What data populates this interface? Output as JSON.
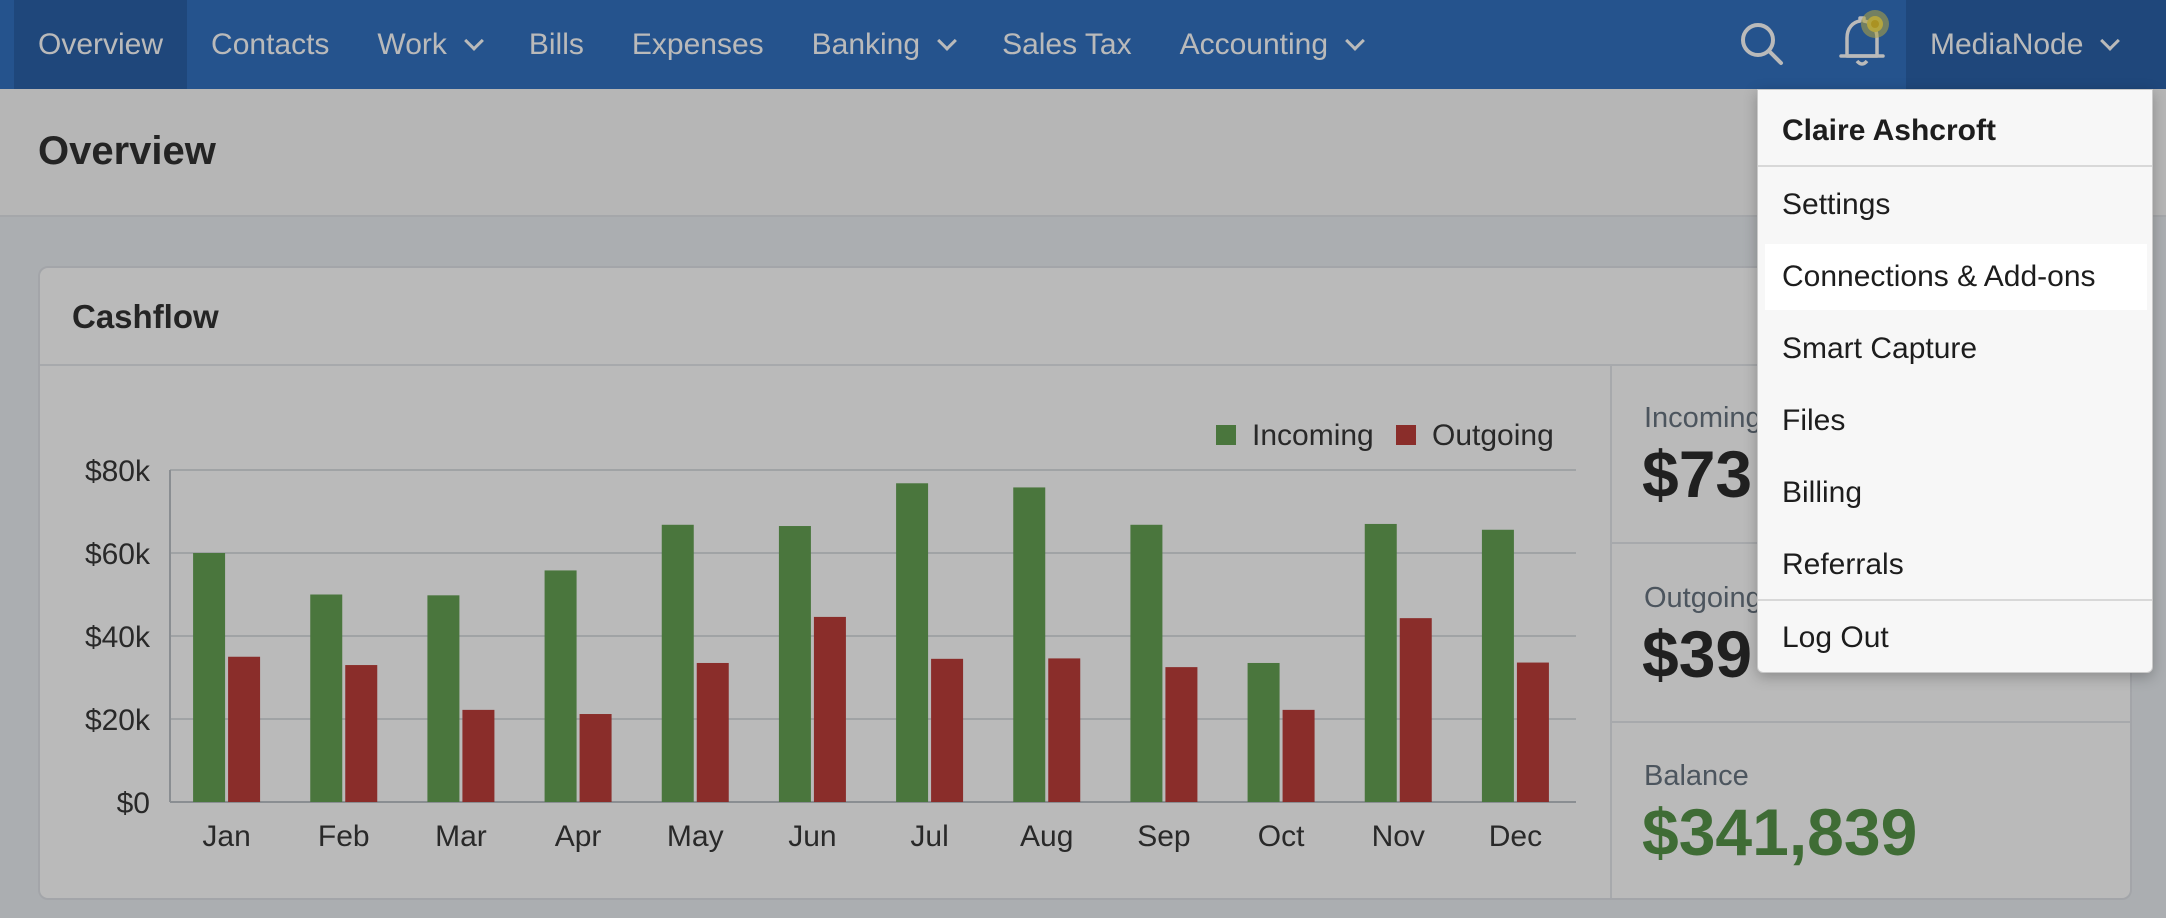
{
  "nav": {
    "items": [
      {
        "label": "Overview",
        "active": true,
        "has_dropdown": false
      },
      {
        "label": "Contacts",
        "active": false,
        "has_dropdown": false
      },
      {
        "label": "Work",
        "active": false,
        "has_dropdown": true
      },
      {
        "label": "Bills",
        "active": false,
        "has_dropdown": false
      },
      {
        "label": "Expenses",
        "active": false,
        "has_dropdown": false
      },
      {
        "label": "Banking",
        "active": false,
        "has_dropdown": true
      },
      {
        "label": "Sales Tax",
        "active": false,
        "has_dropdown": false
      },
      {
        "label": "Accounting",
        "active": false,
        "has_dropdown": true
      }
    ],
    "search_icon": "search-icon",
    "notification_icon": "bell-icon",
    "account_label": "MediaNode"
  },
  "page": {
    "title": "Overview"
  },
  "cashflow": {
    "title": "Cashflow",
    "stats": {
      "incoming_label": "Incoming",
      "incoming_value": "$73",
      "outgoing_label": "Outgoing",
      "outgoing_value": "$39",
      "balance_label": "Balance",
      "balance_value": "$341,839"
    }
  },
  "chart_data": {
    "type": "bar",
    "title": "",
    "xlabel": "",
    "ylabel": "",
    "categories": [
      "Jan",
      "Feb",
      "Mar",
      "Apr",
      "May",
      "Jun",
      "Jul",
      "Aug",
      "Sep",
      "Oct",
      "Nov",
      "Dec"
    ],
    "series": [
      {
        "name": "Incoming",
        "color": "#5a9b48",
        "values": [
          60000,
          50000,
          49800,
          55800,
          66800,
          66500,
          76800,
          75800,
          66800,
          33500,
          67000,
          65600
        ]
      },
      {
        "name": "Outgoing",
        "color": "#b8302b",
        "values": [
          35000,
          33000,
          22200,
          21200,
          33500,
          44600,
          34500,
          34600,
          32500,
          22200,
          44300,
          33600
        ]
      }
    ],
    "yticks": [
      "$0",
      "$20k",
      "$40k",
      "$60k",
      "$80k"
    ],
    "ylim": [
      0,
      80000
    ],
    "grid": true,
    "legend": "top-right"
  },
  "account_menu": {
    "user_name": "Claire Ashcroft",
    "items": [
      {
        "label": "Settings"
      },
      {
        "label": "Connections & Add-ons",
        "highlighted": true
      },
      {
        "label": "Smart Capture"
      },
      {
        "label": "Files"
      },
      {
        "label": "Billing"
      },
      {
        "label": "Referrals"
      }
    ],
    "logout_label": "Log Out"
  }
}
